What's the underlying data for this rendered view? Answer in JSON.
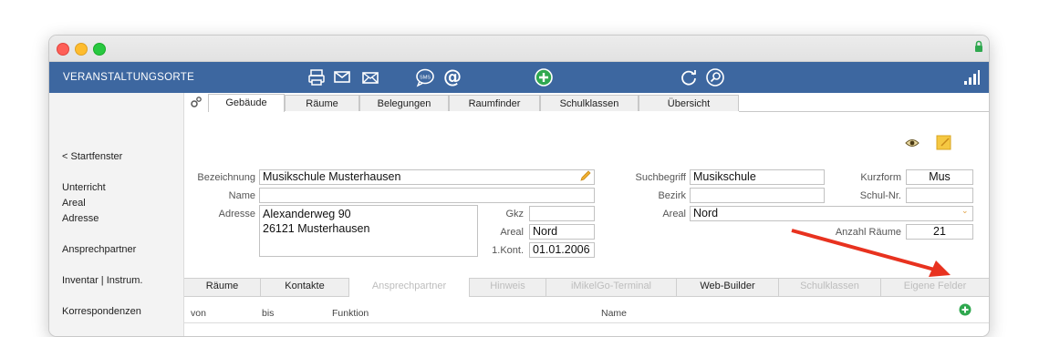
{
  "app": {
    "title": "VERANSTALTUNGSORTE"
  },
  "toolbar": {
    "icons": [
      "printer-icon",
      "mail-icon",
      "mail-open-icon",
      "sms-icon",
      "at-icon",
      "add-icon",
      "refresh-icon",
      "search-icon",
      "signal-icon"
    ],
    "sms_label": "SMS"
  },
  "sidebar": {
    "items": [
      "< Startfenster",
      "Unterricht",
      "Areal",
      "Adresse",
      "Ansprechpartner",
      "Inventar | Instrum.",
      "Korrespondenzen"
    ]
  },
  "tabs": [
    "Gebäude",
    "Räume",
    "Belegungen",
    "Raumfinder",
    "Schulklassen",
    "Übersicht"
  ],
  "form": {
    "bezeichnung_label": "Bezeichnung",
    "bezeichnung": "Musikschule Musterhausen",
    "name_label": "Name",
    "name": "",
    "adresse_label": "Adresse",
    "adresse": "Alexanderweg 90\n26121 Musterhausen",
    "gkz_label": "Gkz",
    "gkz": "",
    "areal_label": "Areal",
    "areal": "Nord",
    "kont_label": "1.Kont.",
    "kont": "01.01.2006",
    "suchbegriff_label": "Suchbegriff",
    "suchbegriff": "Musikschule",
    "bezirk_label": "Bezirk",
    "bezirk": "",
    "areal2_label": "Areal",
    "areal2": "Nord",
    "kurzform_label": "Kurzform",
    "kurzform": "Mus",
    "schulnr_label": "Schul-Nr.",
    "schulnr": "",
    "anzahl_label": "Anzahl Räume",
    "anzahl": "21"
  },
  "subtabs": [
    "Räume",
    "Kontakte",
    "Ansprechpartner",
    "Hinweis",
    "iMikelGo-Terminal",
    "Web-Builder",
    "Schulklassen",
    "Eigene Felder"
  ],
  "table": {
    "columns": [
      "von",
      "bis",
      "Funktion",
      "Name"
    ]
  },
  "colors": {
    "toolbar": "#3d67a0",
    "accent_green": "#2fa84f",
    "arrow_red": "#e8321f"
  }
}
